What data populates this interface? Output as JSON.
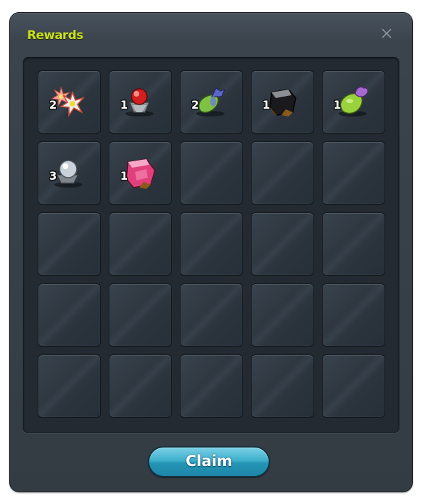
{
  "window": {
    "title": "Rewards",
    "close_icon": "close-x-icon"
  },
  "slots": [
    {
      "item": "flower-bouquet",
      "count": "2"
    },
    {
      "item": "red-ore",
      "count": "1"
    },
    {
      "item": "blue-green-pouch",
      "count": "2"
    },
    {
      "item": "black-crystal",
      "count": "1"
    },
    {
      "item": "green-pouch",
      "count": "1"
    },
    {
      "item": "silver-ore",
      "count": "3"
    },
    {
      "item": "pink-crystal",
      "count": "1"
    },
    {
      "item": null,
      "count": null
    },
    {
      "item": null,
      "count": null
    },
    {
      "item": null,
      "count": null
    },
    {
      "item": null,
      "count": null
    },
    {
      "item": null,
      "count": null
    },
    {
      "item": null,
      "count": null
    },
    {
      "item": null,
      "count": null
    },
    {
      "item": null,
      "count": null
    },
    {
      "item": null,
      "count": null
    },
    {
      "item": null,
      "count": null
    },
    {
      "item": null,
      "count": null
    },
    {
      "item": null,
      "count": null
    },
    {
      "item": null,
      "count": null
    },
    {
      "item": null,
      "count": null
    },
    {
      "item": null,
      "count": null
    },
    {
      "item": null,
      "count": null
    },
    {
      "item": null,
      "count": null
    },
    {
      "item": null,
      "count": null
    }
  ],
  "footer": {
    "claim_label": "Claim"
  },
  "colors": {
    "title": "#c8e11a",
    "button": "#2aa1c3",
    "panel": "#232a32"
  }
}
